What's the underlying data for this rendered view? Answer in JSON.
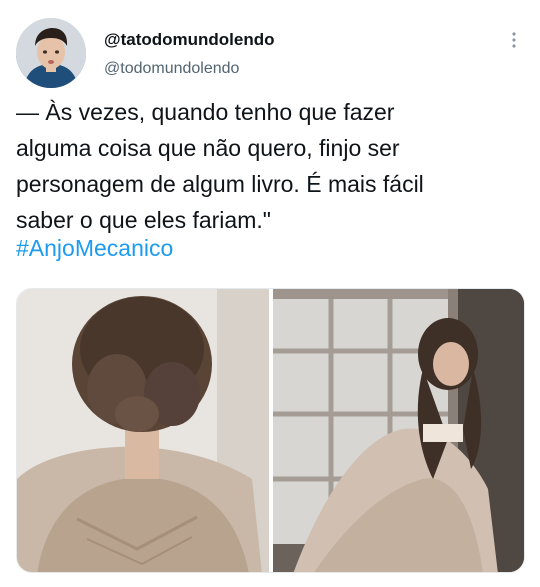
{
  "author": {
    "display_name": "@tatodomundolendo",
    "handle": "@todomundolendo"
  },
  "tweet": {
    "text": "— Às vezes, quando tenho que fazer\nalguma coisa que não quero, finjo ser\npersonagem de algum livro. É mais fácil\nsaber o que eles fariam.\"",
    "hashtag": "#AnjoMecanico"
  },
  "colors": {
    "hashtag": "#1d9bf0",
    "handle": "#536471",
    "text": "#0f1419"
  },
  "icons": {
    "more": "more-dots-vertical-icon"
  }
}
